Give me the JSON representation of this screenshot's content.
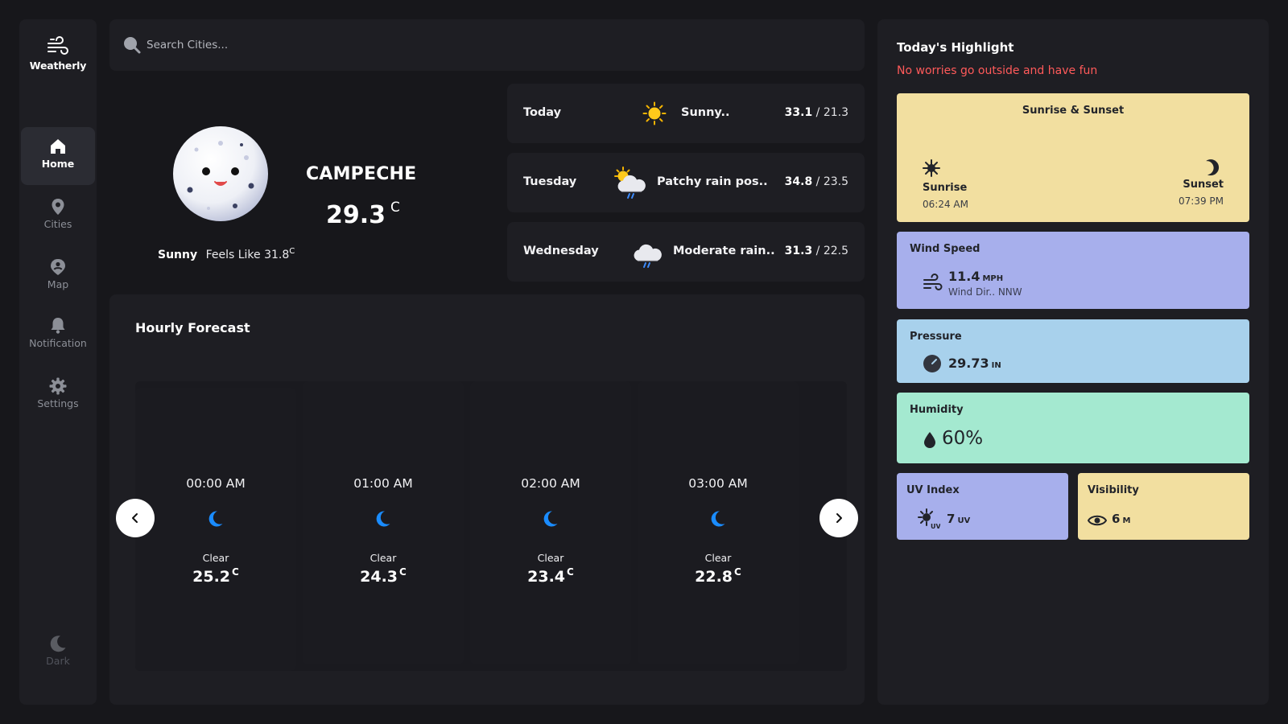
{
  "app": {
    "name": "Weatherly"
  },
  "sidebar": {
    "items": [
      {
        "label": "Home",
        "icon": "home-icon",
        "active": true
      },
      {
        "label": "Cities",
        "icon": "map-pin-icon",
        "active": false
      },
      {
        "label": "Map",
        "icon": "map-user-icon",
        "active": false
      },
      {
        "label": "Notification",
        "icon": "bell-icon",
        "active": false
      },
      {
        "label": "Settings",
        "icon": "gear-icon",
        "active": false
      }
    ],
    "theme_toggle": {
      "label": "Dark",
      "icon": "moon-icon"
    }
  },
  "search": {
    "placeholder": "Search Cities...",
    "value": ""
  },
  "current": {
    "city": "CAMPECHE",
    "temp": "29.3",
    "unit": "C",
    "condition": "Sunny",
    "feels_like_label": "Feels Like",
    "feels_like": "31.8",
    "icon": "smiling-moon-icon"
  },
  "daily": [
    {
      "day": "Today",
      "icon": "sun-icon",
      "condition": "Sunny..",
      "high": "33.1",
      "low": "21.3"
    },
    {
      "day": "Tuesday",
      "icon": "sun-cloud-rain-icon",
      "condition": "Patchy rain pos..",
      "high": "34.8",
      "low": "23.5"
    },
    {
      "day": "Wednesday",
      "icon": "cloud-rain-icon",
      "condition": "Moderate rain..",
      "high": "31.3",
      "low": "22.5"
    }
  ],
  "hourly": {
    "title": "Hourly Forecast",
    "items": [
      {
        "time": "00:00 AM",
        "icon": "crescent-moon-icon",
        "condition": "Clear",
        "temp": "25.2",
        "unit": "C"
      },
      {
        "time": "01:00 AM",
        "icon": "crescent-moon-icon",
        "condition": "Clear",
        "temp": "24.3",
        "unit": "C"
      },
      {
        "time": "02:00 AM",
        "icon": "crescent-moon-icon",
        "condition": "Clear",
        "temp": "23.4",
        "unit": "C"
      },
      {
        "time": "03:00 AM",
        "icon": "crescent-moon-icon",
        "condition": "Clear",
        "temp": "22.8",
        "unit": "C"
      }
    ]
  },
  "highlights": {
    "title": "Today's Highlight",
    "subtitle": "No worries go outside and have fun",
    "sun": {
      "title": "Sunrise & Sunset",
      "sunrise_label": "Sunrise",
      "sunrise": "06:24 AM",
      "sunset_label": "Sunset",
      "sunset": "07:39 PM"
    },
    "wind": {
      "title": "Wind Speed",
      "value": "11.4",
      "unit": "MPH",
      "dir_label": "Wind Dir.. NNW"
    },
    "pressure": {
      "title": "Pressure",
      "value": "29.73",
      "unit": "IN"
    },
    "humidity": {
      "title": "Humidity",
      "value": "60%"
    },
    "uv": {
      "title": "UV Index",
      "value": "7",
      "unit": "UV"
    },
    "visibility": {
      "title": "Visibility",
      "value": "6",
      "unit": "M"
    }
  },
  "colors": {
    "background": "#17171b",
    "panel": "#1e1e23",
    "accent_red": "#ff5a5a",
    "card_yellow": "#f2dfa0",
    "card_purple": "#a7afec",
    "card_blue": "#a8d1ec",
    "card_green": "#a4e9d0",
    "moon_blue": "#1a8cff"
  }
}
